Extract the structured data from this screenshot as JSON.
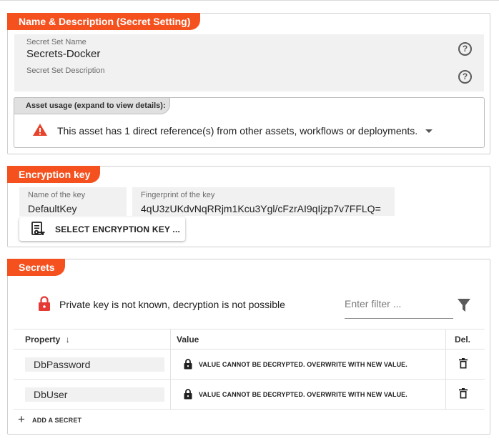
{
  "colors": {
    "accent": "#f4511e",
    "warning": "#e8442c",
    "lock_red": "#e53935",
    "field_bg": "#f1f1f1"
  },
  "name_section": {
    "title": "Name & Description (Secret Setting)",
    "name_field": {
      "label": "Secret Set Name",
      "value": "Secrets-Docker"
    },
    "description_field": {
      "label": "Secret Set Description",
      "value": ""
    },
    "help_icon": "?"
  },
  "asset_usage": {
    "tab_label": "Asset usage (expand to view details):",
    "message": "This asset has 1 direct reference(s) from other assets, workflows or deployments."
  },
  "encryption_section": {
    "title": "Encryption key",
    "key_name": {
      "label": "Name of the key",
      "value": "DefaultKey"
    },
    "fingerprint": {
      "label": "Fingerprint of the key",
      "value": "4qU3zUKdvNqRRjm1Kcu3Ygl/cFzrAI9qIjzp7v7FFLQ="
    },
    "select_button": "SELECT ENCRYPTION KEY ..."
  },
  "secrets_section": {
    "title": "Secrets",
    "notice": "Private key is not known, decryption is not possible",
    "filter_placeholder": "Enter filter ...",
    "columns": {
      "property": "Property",
      "sort_arrow": "↓",
      "value": "Value",
      "del": "Del."
    },
    "rows": [
      {
        "property": "DbPassword",
        "value": "VALUE CANNOT BE DECRYPTED. OVERWRITE WITH NEW VALUE."
      },
      {
        "property": "DbUser",
        "value": "VALUE CANNOT BE DECRYPTED. OVERWRITE WITH NEW VALUE."
      }
    ],
    "add_label": "ADD A SECRET",
    "add_icon": "+"
  }
}
